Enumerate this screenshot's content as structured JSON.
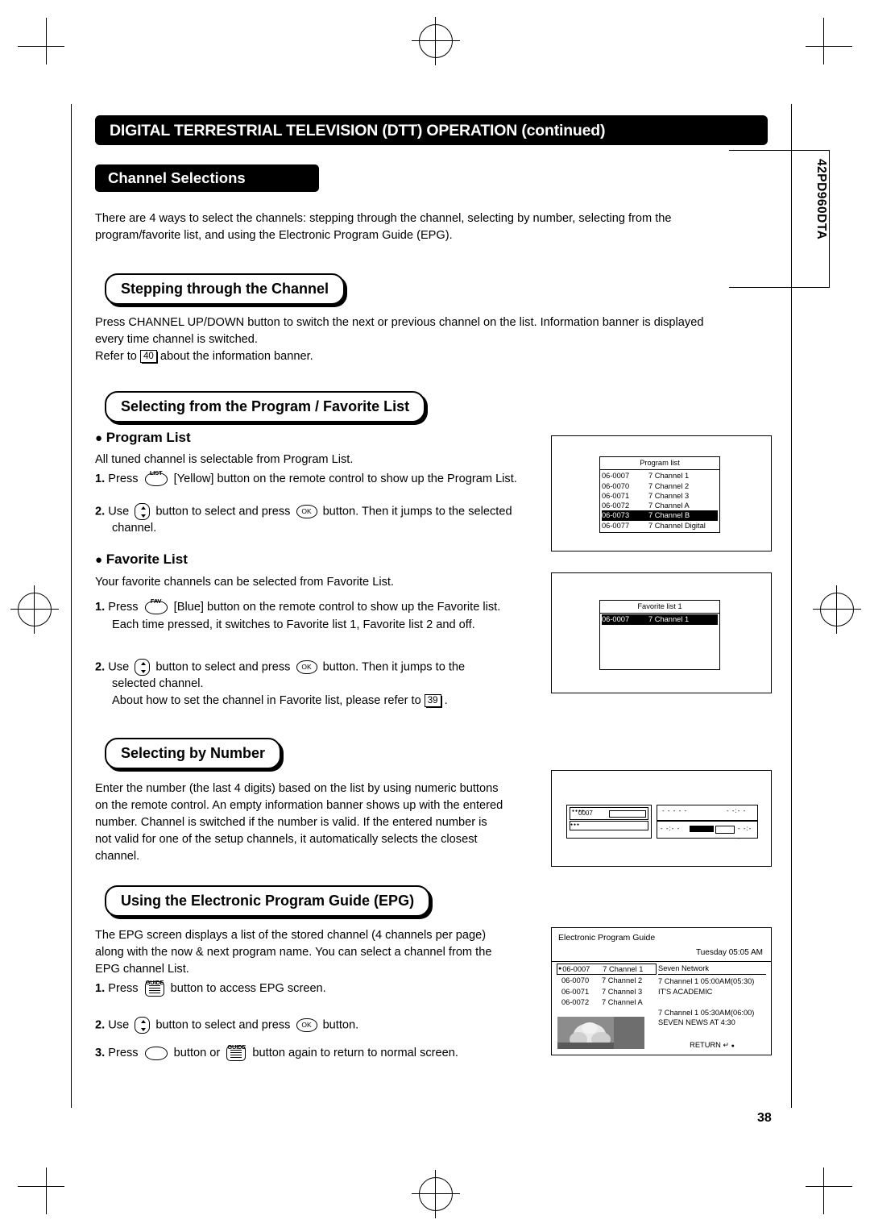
{
  "header": {
    "title": "DIGITAL TERRESTRIAL TELEVISION (DTT) OPERATION (continued)",
    "subtitle": "Channel Selections",
    "side_label": "42PD960DTA",
    "page_number": "38"
  },
  "intro": {
    "line1": "There are 4 ways to select the channels: stepping through the channel, selecting by number, selecting from the",
    "line2": "program/favorite list, and using the Electronic Program Guide (EPG)."
  },
  "sections": {
    "stepping": {
      "heading": "Stepping through the Channel",
      "p1": "Press CHANNEL UP/DOWN button to switch the next or previous channel on the list. Information banner is displayed",
      "p2": "every time channel is switched.",
      "p3_pre": "Refer to",
      "p3_ref": "40",
      "p3_post": "about the information banner."
    },
    "program_favorite": {
      "heading": "Selecting from the Program / Favorite List",
      "program_list": {
        "bullet": "Program List",
        "desc": "All tuned channel is selectable from Program List.",
        "step1_num": "1.",
        "step1_pre": "Press",
        "step1_key": "LIST",
        "step1_post": "[Yellow] button on the remote control to show up the Program List.",
        "step2_num": "2.",
        "step2_pre": "Use",
        "step2_mid": "button to select and press",
        "step2_ok": "OK",
        "step2_post": "button. Then it jumps to the selected",
        "step2_line2": "channel."
      },
      "favorite_list": {
        "bullet": "Favorite List",
        "desc": "Your favorite channels can be selected from Favorite List.",
        "step1_num": "1.",
        "step1_pre": "Press",
        "step1_key": "FAV",
        "step1_post": "[Blue] button on the remote control to show up the Favorite list.",
        "step1_line2": "Each time pressed, it switches to Favorite list 1, Favorite list 2 and off.",
        "step2_num": "2.",
        "step2_pre": "Use",
        "step2_mid": "button to select and press",
        "step2_ok": "OK",
        "step2_post": "button. Then it jumps to the",
        "step2_line2": "selected channel.",
        "step2_line3_pre": "About how to set the channel in Favorite list, please refer to",
        "step2_line3_ref": "39",
        "step2_line3_post": "."
      }
    },
    "by_number": {
      "heading": "Selecting by Number",
      "p1": "Enter the number (the last 4 digits) based on the list by using numeric buttons",
      "p2": "on the remote control. An empty information banner shows up with the entered",
      "p3": "number. Channel is switched if the number is valid. If the entered number is",
      "p4": "not valid for one of the setup channels, it automatically selects the closest",
      "p5": "channel."
    },
    "epg": {
      "heading": "Using the Electronic Program Guide (EPG)",
      "p1": "The EPG screen displays a list of the stored channel (4 channels per page)",
      "p2": "along with the now & next program name. You can select a channel from the",
      "p3": "EPG channel List.",
      "step1_num": "1.",
      "step1_pre": "Press",
      "step1_key": "GUIDE",
      "step1_post": "button to access EPG screen.",
      "step2_num": "2.",
      "step2_pre": "Use",
      "step2_mid": "button to select and press",
      "step2_ok": "OK",
      "step2_post": "button.",
      "step3_num": "3.",
      "step3_pre": "Press",
      "step3_mid": "button or",
      "step3_key": "GUIDE",
      "step3_post": "button again to return to normal screen."
    }
  },
  "osd": {
    "program_list": {
      "title": "Program list",
      "rows": [
        {
          "num": "06-0007",
          "name": "7 Channel 1",
          "highlight": false
        },
        {
          "num": "06-0070",
          "name": "7 Channel 2",
          "highlight": false
        },
        {
          "num": "06-0071",
          "name": "7 Channel 3",
          "highlight": false
        },
        {
          "num": "06-0072",
          "name": "7 Channel A",
          "highlight": false
        },
        {
          "num": "06-0073",
          "name": "7 Channel B",
          "highlight": true
        },
        {
          "num": "06-0077",
          "name": "7 Channel Digital",
          "highlight": false
        }
      ]
    },
    "favorite_list": {
      "title": "Favorite list 1",
      "rows": [
        {
          "num": "06-0007",
          "name": "7 Channel 1",
          "highlight": true
        }
      ]
    },
    "banner": {
      "channel_number": "0007"
    },
    "epg": {
      "title": "Electronic Program Guide",
      "datetime": "Tuesday 05:05 AM",
      "channels": [
        {
          "num": "06-0007",
          "name": "7 Channel 1",
          "marker": true
        },
        {
          "num": "06-0070",
          "name": "7 Channel 2",
          "marker": false
        },
        {
          "num": "06-0071",
          "name": "7 Channel 3",
          "marker": false
        },
        {
          "num": "06-0072",
          "name": "7 Channel A",
          "marker": false
        }
      ],
      "network": "Seven Network",
      "now_time": "7 Channel 1   05:00AM(05:30)",
      "now_prog": "IT'S ACADEMIC",
      "next_time": "7 Channel 1   05:30AM(06:00)",
      "next_prog": "SEVEN NEWS AT 4:30",
      "return_label": "RETURN"
    }
  }
}
